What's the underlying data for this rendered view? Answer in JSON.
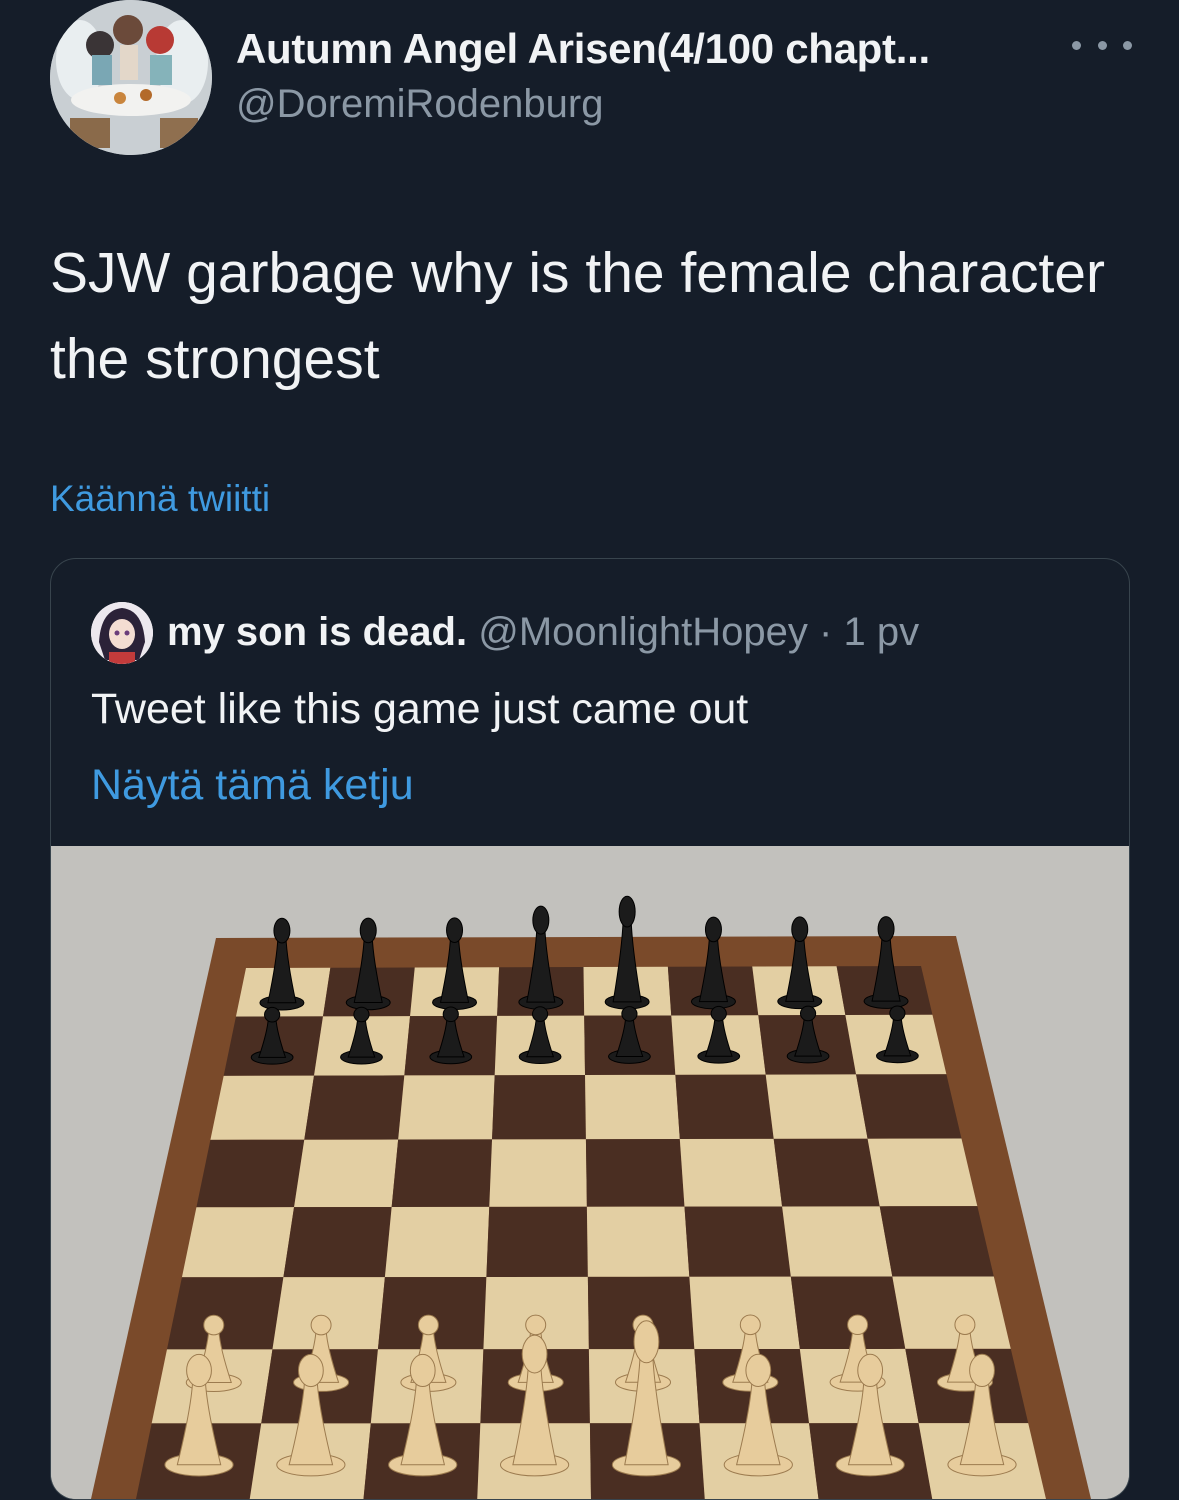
{
  "tweet": {
    "author": {
      "display_name": "Autumn Angel Arisen(4/100 chapt...",
      "handle": "@DoremiRodenburg",
      "avatar_icon": "anime-angels-avatar"
    },
    "more_icon": "ellipsis-icon",
    "text": "SJW garbage why is the female character the strongest",
    "translate_label": "Käännä twiitti"
  },
  "quoted_tweet": {
    "author": {
      "display_name": "my son is dead.",
      "handle": "@MoonlightHopey",
      "separator": "·",
      "time": "1 pv",
      "avatar_icon": "anime-girl-avatar"
    },
    "text": "Tweet like this game just came out",
    "thread_label": "Näytä tämä ketju",
    "media": {
      "description_icon": "chessboard-photo",
      "board_size": 8
    }
  },
  "colors": {
    "background": "#151d29",
    "link": "#3f9ae0",
    "secondary_text": "#8b98a5",
    "card_border": "#38444d"
  }
}
